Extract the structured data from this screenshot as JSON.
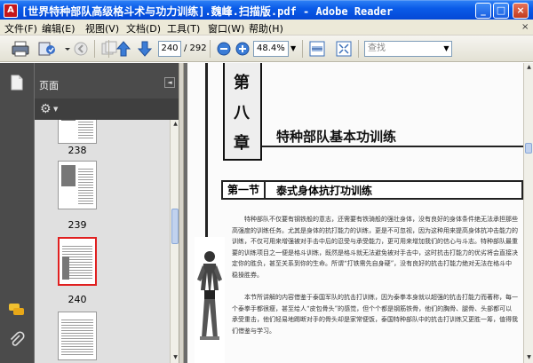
{
  "window": {
    "title": "[世界特种部队高级格斗术与功力训练].魏峰.扫描版.pdf - Adobe Reader",
    "app_icon": "adobe-reader-icon",
    "minimize": "_",
    "maximize": "□",
    "close": "×"
  },
  "menu": {
    "items": [
      "文件(F)",
      "编辑(E)",
      "视图(V)",
      "文档(D)",
      "工具(T)",
      "窗口(W)",
      "帮助(H)"
    ],
    "close_doc": "×"
  },
  "toolbar": {
    "current_page": "240",
    "total_pages": "/ 292",
    "zoom": "48.4%",
    "zoom_dropdown": "▼",
    "search_placeholder": "查找",
    "search_dropdown": "▼"
  },
  "panel": {
    "label": "页面",
    "collapse": "◄",
    "options_icon": "gear-icon",
    "options_caret": "▼",
    "thumbnails": [
      {
        "label": "238"
      },
      {
        "label": "239"
      },
      {
        "label": "240",
        "selected": true
      },
      {
        "label": ""
      }
    ]
  },
  "document": {
    "chapter_chars": [
      "第",
      "八",
      "章"
    ],
    "chapter_title": "特种部队基本功训练",
    "section_num": "第一节",
    "section_title": "泰式身体抗打功训练",
    "paragraphs": [
      "特种部队不仅要有钢铁般的意志，还需要有铁骑般的强壮身体，没有良好的身体条件绝无法承担那些高强度的训练任务。尤其是身体的抗打能力的训练，更是不可忽视，因为这种用来提高身体抗冲击能力的训练，不仅可用来增强被对手击中后的忍受与承受能力，更可用来增加我们的信心与斗志。特种部队最重要的训练项目之一便是格斗训练，既然是格斗就无法避免被对手击中，这时抗击打能力的优劣将会直接决定你的胜负，甚至关系到你的生命。所谓“打铁需先自身硬”，没有良好的抗击打能力绝对无法在格斗中稳操胜券。",
      "本节所讲解的内容借鉴于泰国军队的抗击打训练，因为泰拳本身就以超强的抗击打能力而著称，每一个泰拳手都很瘦，甚至给人“皮包骨头”的感觉，但个个都是钢筋铁骨，他们的胸骨、腿骨、头部都可以承受重击，他们轻易地踢断对手的骨头却是家常便饭，泰国特种部队中的抗击打训练又更胜一筹，值得我们借鉴与学习。"
    ]
  },
  "colors": {
    "titlebar": "#0a5be8",
    "selection": "#e02020",
    "dark_panel": "#4b4b4b"
  }
}
